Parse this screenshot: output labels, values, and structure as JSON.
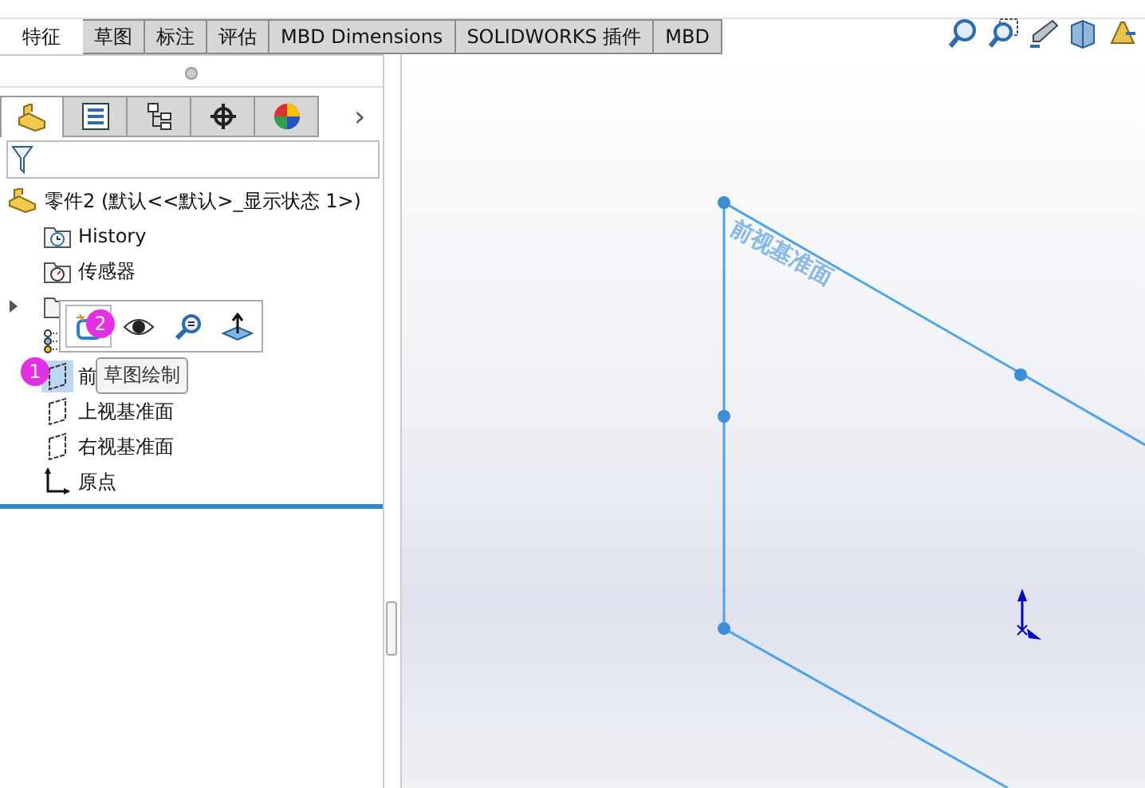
{
  "tabs": [
    {
      "label": "特征",
      "selected": true
    },
    {
      "label": "草图",
      "selected": false
    },
    {
      "label": "标注",
      "selected": false
    },
    {
      "label": "评估",
      "selected": false
    },
    {
      "label": "MBD Dimensions",
      "selected": false
    },
    {
      "label": "SOLIDWORKS 插件",
      "selected": false
    },
    {
      "label": "MBD",
      "selected": false
    }
  ],
  "panel_tabs": [
    {
      "kind": "feature",
      "selected": true
    },
    {
      "kind": "property",
      "selected": false
    },
    {
      "kind": "config",
      "selected": false
    },
    {
      "kind": "dim",
      "selected": false
    },
    {
      "kind": "display",
      "selected": false
    }
  ],
  "tree": {
    "root": "零件2  (默认<<默认>_显示状态 1>)",
    "items": [
      {
        "kind": "history",
        "label": "History",
        "selected": false
      },
      {
        "kind": "sensor",
        "label": "传感器",
        "selected": false
      },
      {
        "kind": "annotation",
        "selected": false,
        "expanded": false
      },
      {
        "kind": "material",
        "selected": false
      },
      {
        "kind": "plane",
        "label": "前",
        "selected": true
      },
      {
        "kind": "plane",
        "label": "上视基准面",
        "selected": false
      },
      {
        "kind": "plane",
        "label": "右视基准面",
        "selected": false
      },
      {
        "kind": "origin",
        "label": "原点",
        "selected": false
      }
    ]
  },
  "context_toolbar": {
    "buttons": [
      {
        "kind": "sketch"
      },
      {
        "kind": "view"
      },
      {
        "kind": "zoom"
      },
      {
        "kind": "normal"
      }
    ]
  },
  "panel_more": "›",
  "tooltip": "草图绘制",
  "callouts": [
    "1",
    "2"
  ],
  "graphics": {
    "plane_label": "前视基准面"
  }
}
